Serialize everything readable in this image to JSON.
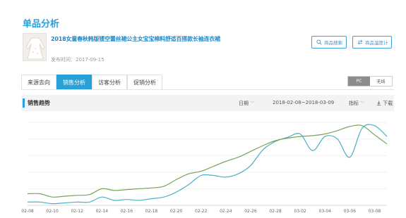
{
  "page": {
    "title": "单品分析"
  },
  "product": {
    "name": "2018女童春秋韩版镂空蕾丝裙公主女宝宝棉料舒适百搭款长袖连衣裙",
    "publish": "发布时间：2017-09-15"
  },
  "buttons": {
    "search": "商品搜索",
    "temperature": "商品温度计"
  },
  "tabs": [
    "来源去向",
    "销售分析",
    "访客分析",
    "促销分析"
  ],
  "active_tab": 1,
  "device_toggle": {
    "pc": "PC",
    "wireless": "无线",
    "active": "PC"
  },
  "trend": {
    "title": "销售趋势",
    "date_label": "日期",
    "date_range": "2018-02-08~2018-03-09",
    "metric_label": "指标",
    "download_label": "下载"
  },
  "colors": {
    "accent": "#2aa0d8",
    "series_teal": "#4aaec4",
    "series_green": "#7aa35a"
  },
  "chart_data": {
    "type": "line",
    "x": [
      "02-08",
      "02-09",
      "02-10",
      "02-11",
      "02-12",
      "02-13",
      "02-14",
      "02-15",
      "02-16",
      "02-17",
      "02-18",
      "02-19",
      "02-20",
      "02-21",
      "02-22",
      "02-23",
      "02-24",
      "02-25",
      "02-26",
      "02-27",
      "02-28",
      "03-01",
      "03-02",
      "03-03",
      "03-04",
      "03-05",
      "03-06",
      "03-07",
      "03-08",
      "03-09"
    ],
    "tick_labels": [
      "02-08",
      "02-10",
      "02-12",
      "02-14",
      "02-16",
      "02-18",
      "02-20",
      "02-22",
      "02-24",
      "02-26",
      "02-28",
      "03-02",
      "03-04",
      "03-06",
      "03-08"
    ],
    "grid": true,
    "series": [
      {
        "color": "#4aaec4",
        "values": [
          4,
          4,
          2,
          3,
          4,
          4,
          10,
          6,
          7,
          6,
          8,
          10,
          16,
          25,
          36,
          36,
          34,
          38,
          48,
          67,
          77,
          82,
          86,
          66,
          83,
          80,
          58,
          93,
          96,
          83
        ]
      },
      {
        "color": "#7aa35a",
        "values": [
          14,
          14,
          10,
          11,
          12,
          13,
          20,
          18,
          19,
          20,
          21,
          23,
          31,
          38,
          41,
          47,
          53,
          58,
          65,
          72,
          78,
          81,
          83,
          84,
          86,
          90,
          95,
          96,
          85,
          74
        ]
      }
    ]
  }
}
